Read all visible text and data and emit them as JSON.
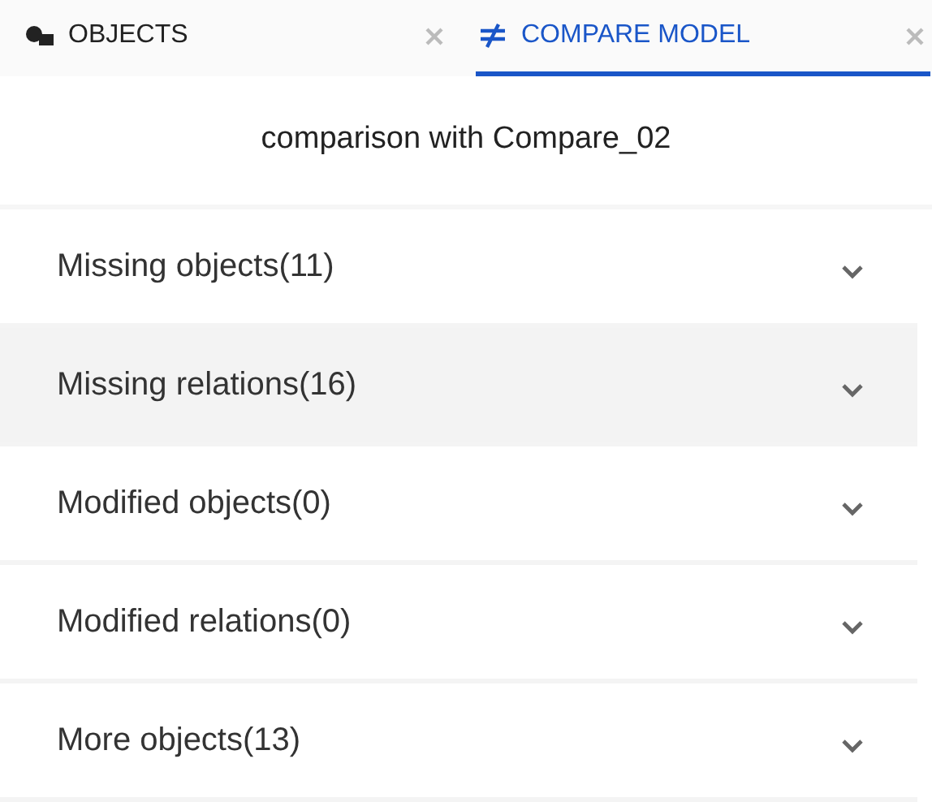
{
  "tabs": [
    {
      "label": "OBJECTS",
      "selected": false
    },
    {
      "label": "COMPARE MODEL",
      "selected": true
    }
  ],
  "heading": "comparison with Compare_02",
  "sections": [
    {
      "label": "Missing objects(11)",
      "highlighted": false,
      "expanded": false
    },
    {
      "label": "Missing relations(16)",
      "highlighted": true,
      "expanded": false
    },
    {
      "label": "Modified objects(0)",
      "highlighted": false,
      "expanded": false
    },
    {
      "label": "Modified relations(0)",
      "highlighted": false,
      "expanded": false
    },
    {
      "label": "More objects(13)",
      "highlighted": false,
      "expanded": false
    }
  ]
}
